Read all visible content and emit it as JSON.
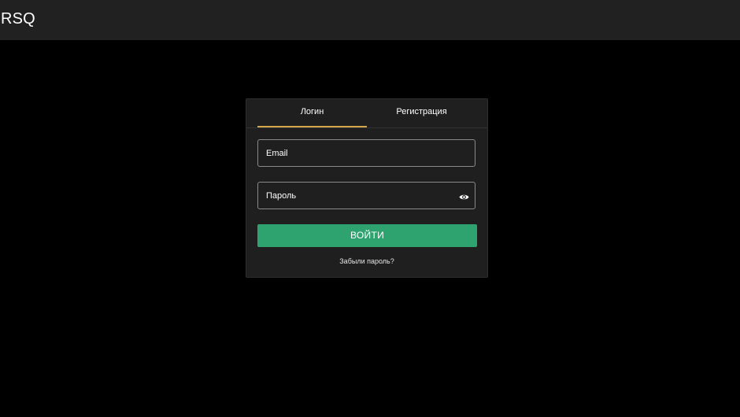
{
  "header": {
    "brand": "RSQ"
  },
  "auth": {
    "tabs": [
      {
        "label": "Логин",
        "active": true
      },
      {
        "label": "Регистрация",
        "active": false
      }
    ],
    "email_placeholder": "Email",
    "password_placeholder": "Пароль",
    "password_toggle_icon": "eye-icon",
    "submit_label": "ВОЙТИ",
    "forgot_label": "Забыли пароль?"
  },
  "colors": {
    "background": "#000000",
    "topbar": "#212121",
    "card": "#1f1f1f",
    "active_tab_underline": "#d4a84a",
    "submit_button": "#2fa36f"
  }
}
